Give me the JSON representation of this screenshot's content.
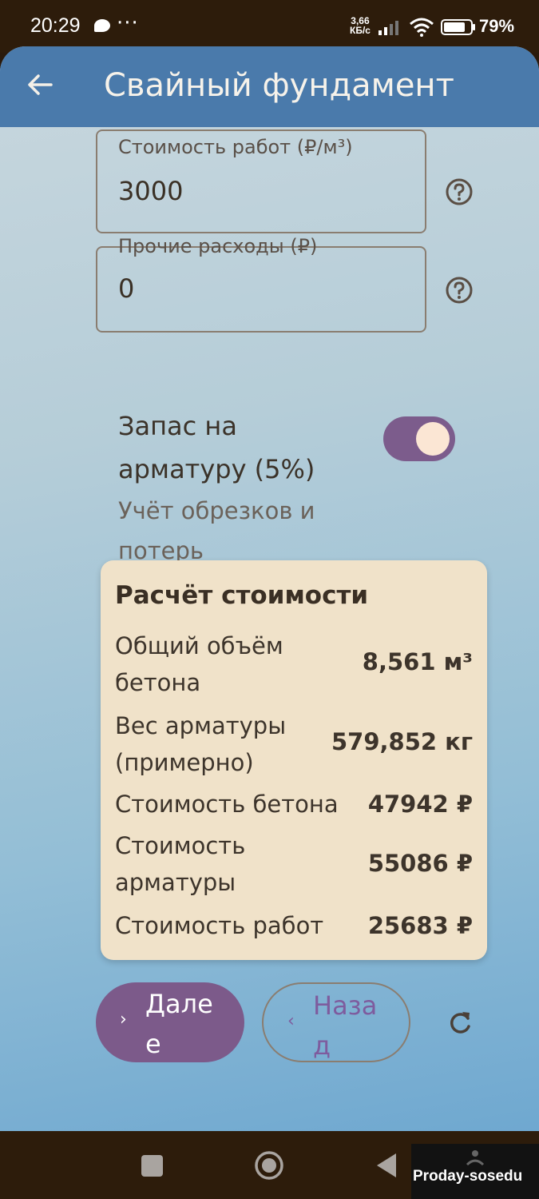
{
  "status_bar": {
    "time": "20:29",
    "more": "···",
    "speed_value": "3,66",
    "speed_unit": "КБ/с",
    "battery": "79%"
  },
  "app_bar": {
    "title": "Свайный фундамент"
  },
  "fields": {
    "work_cost": {
      "label": "Стоимость работ (₽/м³)",
      "value": "3000"
    },
    "other_expenses": {
      "label": "Прочие расходы (₽)",
      "value": "0"
    }
  },
  "rebar_reserve": {
    "title": "Запас на арматуру (5%)",
    "subtitle": "Учёт обрезков и потерь",
    "enabled": true
  },
  "cost_card": {
    "title": "Расчёт стоимости",
    "rows": [
      {
        "label": "Общий объём бетона",
        "value": "8,561 м³"
      },
      {
        "label": "Вес арматуры (примерно)",
        "value": "579,852 кг"
      },
      {
        "label": "Стоимость бетона",
        "value": "47942 ₽"
      },
      {
        "label": "Стоимость арматуры",
        "value": "55086 ₽"
      },
      {
        "label": "Стоимость работ",
        "value": "25683 ₽"
      }
    ]
  },
  "buttons": {
    "next": "Далее",
    "back": "Назад"
  },
  "watermark": "Proday-sosedu",
  "colors": {
    "app_bar": "#4a7aab",
    "accent": "#7c5a8a",
    "card": "#f0e2c9",
    "status_bar": "#2d1c0b"
  }
}
